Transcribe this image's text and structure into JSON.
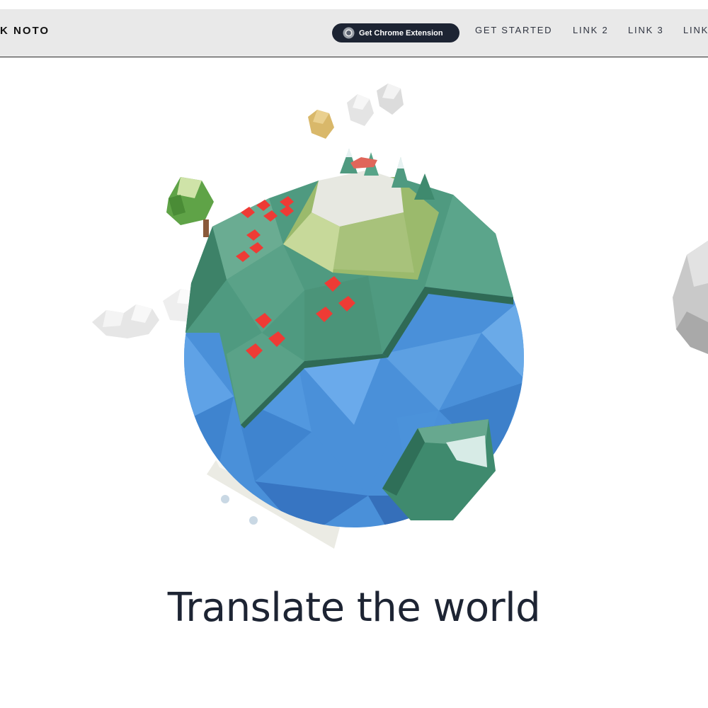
{
  "header": {
    "brand": "K NOTO",
    "cta_label": "Get Chrome Extension",
    "cta_icon": "chrome-icon",
    "links": [
      "GET STARTED",
      "LINK 2",
      "LINK 3",
      "LINK"
    ]
  },
  "hero": {
    "illustration": "low-poly-globe",
    "headline": "Translate the world"
  },
  "colors": {
    "nav_background": "#e9e9e9",
    "button_background": "#1d2433",
    "ocean": "#4a90d9",
    "land": "#4f9a80",
    "houses": "#ee3b35",
    "headline_text": "#1d2433"
  }
}
